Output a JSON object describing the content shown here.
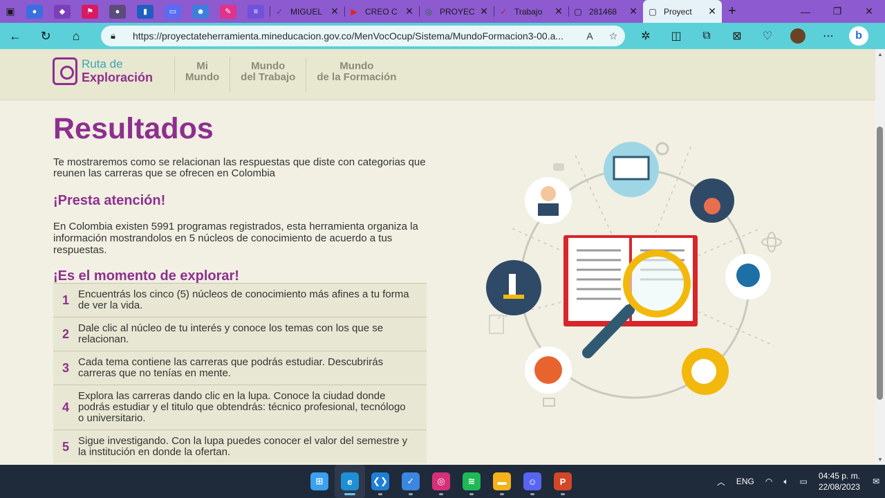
{
  "browser": {
    "pinned_tabs": [
      {
        "icon": "folder-icon",
        "color": "#3b6fe0",
        "glyph": "●"
      },
      {
        "icon": "app-icon",
        "color": "#7b3fb8",
        "glyph": "◆"
      },
      {
        "icon": "flag-icon",
        "color": "#d81b60",
        "glyph": "⚑"
      },
      {
        "icon": "app-icon",
        "color": "#5b4c7a",
        "glyph": "●"
      },
      {
        "icon": "book-icon",
        "color": "#1f5fbf",
        "glyph": "▮"
      },
      {
        "icon": "screen-icon",
        "color": "#5a6cf2",
        "glyph": "▭"
      },
      {
        "icon": "person-icon",
        "color": "#3f7fdc",
        "glyph": "☻"
      },
      {
        "icon": "tool-icon",
        "color": "#e0338a",
        "glyph": "✎"
      },
      {
        "icon": "app-icon",
        "color": "#6f52d9",
        "glyph": "≡"
      }
    ],
    "tabs": [
      {
        "title": "MIGUEL",
        "icon": "check-icon",
        "glyph": "✓",
        "color": "#5a2f7a"
      },
      {
        "title": "CREO C",
        "icon": "youtube-icon",
        "glyph": "▶",
        "color": "#e62117"
      },
      {
        "title": "PROYEC",
        "icon": "globe-icon",
        "glyph": "◎",
        "color": "#2b6f3a"
      },
      {
        "title": "Trabajo",
        "icon": "check-icon",
        "glyph": "✓",
        "color": "#c0173b"
      },
      {
        "title": "281468",
        "icon": "document-icon",
        "glyph": "▢",
        "color": "#1b1b1b"
      },
      {
        "title": "Proyect",
        "icon": "document-icon",
        "glyph": "▢",
        "color": "#1b1b1b",
        "active": true
      }
    ],
    "url": "https://proyectateherramienta.mineducacion.gov.co/MenVocOcup/Sistema/MundoFormacion3-00.a..."
  },
  "site": {
    "logo_line1": "Ruta de",
    "logo_line2": "Exploración",
    "nav": [
      "Mi\nMundo",
      "Mundo\ndel Trabajo",
      "Mundo\nde la Formación"
    ]
  },
  "content": {
    "title": "Resultados",
    "intro": "Te mostraremos como se relacionan las respuestas que diste con categorias que reunen las carreras que se ofrecen en Colombia",
    "attention_heading": "¡Presta atención!",
    "attention_text": "En Colombia existen 5991 programas registrados, esta herramienta organiza la información mostrandolos en 5 núcleos de conocimiento de acuerdo a tus respuestas.",
    "explore_heading": "¡Es el momento de explorar!",
    "steps": [
      {
        "num": "1",
        "text": "Encuentrás los cinco (5) núcleos de conocimiento más afines a tu forma de ver la vida."
      },
      {
        "num": "2",
        "text": "Dale clic al núcleo de tu interés y conoce los temas con los que se relacionan."
      },
      {
        "num": "3",
        "text": "Cada tema contiene las carreras que podrás estudiar. Descubrirás carreras que no tenías en mente."
      },
      {
        "num": "4",
        "text": "Explora las carreras dando clic en la lupa. Conoce la ciudad donde podrás estudiar y el titulo que obtendrás: técnico profesional, tecnólogo o universitario."
      },
      {
        "num": "5",
        "text": "Sigue investigando. Con la lupa puedes conocer el valor del semestre y la institución en donde la ofertan."
      }
    ]
  },
  "taskbar": {
    "apps": [
      {
        "name": "windows-start-icon",
        "color": "#3aa0f0",
        "glyph": "⊞"
      },
      {
        "name": "edge-icon",
        "color": "#1e8fd6",
        "glyph": "e",
        "active": true
      },
      {
        "name": "vscode-icon",
        "color": "#1f7fd4",
        "glyph": "❮❯"
      },
      {
        "name": "todo-icon",
        "color": "#3a86e0",
        "glyph": "✓"
      },
      {
        "name": "instagram-icon",
        "color": "#d6307a",
        "glyph": "◎"
      },
      {
        "name": "spotify-icon",
        "color": "#1db954",
        "glyph": "≋"
      },
      {
        "name": "file-explorer-icon",
        "color": "#f3b21a",
        "glyph": "▬"
      },
      {
        "name": "discord-icon",
        "color": "#5865f2",
        "glyph": "☺"
      },
      {
        "name": "powerpoint-icon",
        "color": "#d24726",
        "glyph": "P"
      }
    ],
    "lang": "ENG",
    "time": "04:45 p. m.",
    "date": "22/08/2023"
  }
}
